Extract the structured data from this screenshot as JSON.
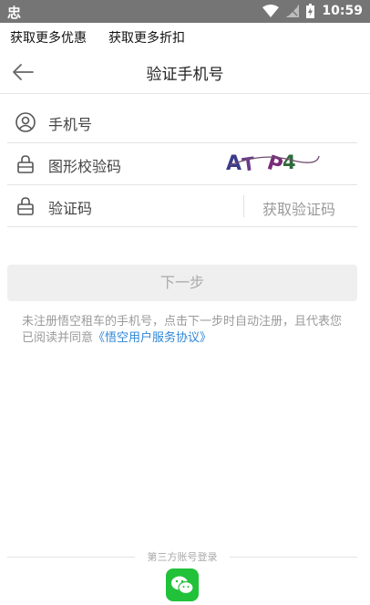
{
  "status_bar": {
    "time": "10:59",
    "left_glyph": "忠"
  },
  "promo": {
    "item1": "获取更多优惠",
    "item2": "获取更多折扣"
  },
  "header": {
    "title": "验证手机号"
  },
  "form": {
    "phone_placeholder": "手机号",
    "captcha_placeholder": "图形校验码",
    "captcha_image_text": "AT P4",
    "code_placeholder": "验证码",
    "get_code_label": "获取验证码"
  },
  "next_button": {
    "label": "下一步"
  },
  "notice": {
    "text": "未注册悟空租车的手机号，点击下一步时自动注册，且代表您已阅读并同意",
    "link": "《悟空用户服务协议》"
  },
  "third_party": {
    "label": "第三方账号登录"
  },
  "icons": [
    "wifi-icon",
    "signal-icon",
    "battery-icon",
    "back-arrow-icon",
    "user-icon",
    "lock-icon",
    "wechat-icon"
  ]
}
